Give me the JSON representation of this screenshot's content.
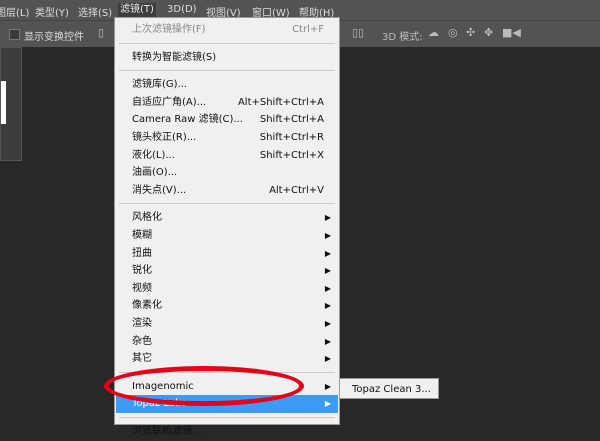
{
  "menubar": [
    "图层(L)",
    "类型(Y)",
    "选择(S)",
    "滤镜(T)",
    "3D(D)",
    "视图(V)",
    "窗口(W)",
    "帮助(H)"
  ],
  "options": {
    "show_transform": "显示变换控件",
    "mode3d": "3D 模式:"
  },
  "menu": [
    {
      "label": "上次滤镜操作(F)",
      "shortcut": "Ctrl+F",
      "disabled": true
    },
    {
      "sep": true
    },
    {
      "label": "转换为智能滤镜(S)"
    },
    {
      "sep": true
    },
    {
      "label": "滤镜库(G)..."
    },
    {
      "label": "自适应广角(A)...",
      "shortcut": "Alt+Shift+Ctrl+A"
    },
    {
      "label": "Camera Raw 滤镜(C)...",
      "shortcut": "Shift+Ctrl+A"
    },
    {
      "label": "镜头校正(R)...",
      "shortcut": "Shift+Ctrl+R"
    },
    {
      "label": "液化(L)...",
      "shortcut": "Shift+Ctrl+X"
    },
    {
      "label": "油画(O)..."
    },
    {
      "label": "消失点(V)...",
      "shortcut": "Alt+Ctrl+V"
    },
    {
      "sep": true
    },
    {
      "label": "风格化",
      "sub": true
    },
    {
      "label": "模糊",
      "sub": true
    },
    {
      "label": "扭曲",
      "sub": true
    },
    {
      "label": "锐化",
      "sub": true
    },
    {
      "label": "视频",
      "sub": true
    },
    {
      "label": "像素化",
      "sub": true
    },
    {
      "label": "渲染",
      "sub": true
    },
    {
      "label": "杂色",
      "sub": true
    },
    {
      "label": "其它",
      "sub": true
    },
    {
      "sep": true
    },
    {
      "label": "Imagenomic",
      "sub": true
    },
    {
      "label": "Topaz Labs",
      "sub": true,
      "highlighted": true
    },
    {
      "sep": true
    },
    {
      "label": "浏览联机滤镜..."
    }
  ],
  "submenu": {
    "item": "Topaz Clean 3..."
  },
  "colors": {
    "highlight": "#3c9bf4",
    "annotation": "#e6001a"
  }
}
